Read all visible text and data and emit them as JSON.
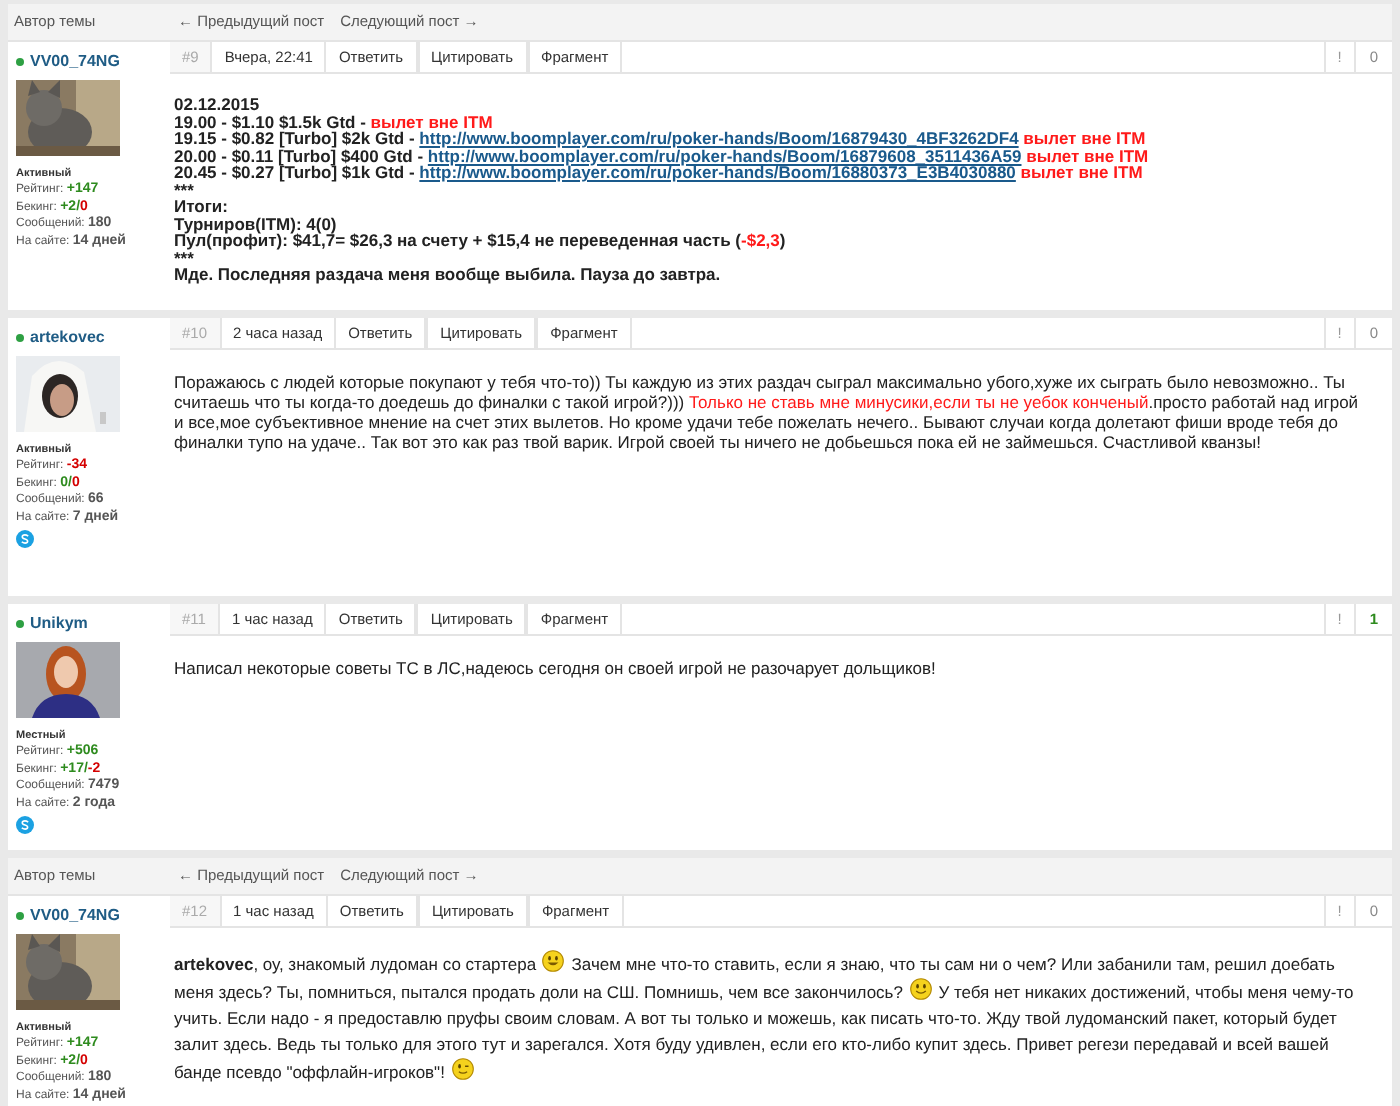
{
  "posts": [
    {
      "topic_starter_bar": {
        "label": "Автор темы",
        "prev": "← Предыдущий пост",
        "next": "Следующий пост →"
      },
      "author": {
        "name": "VV00_74NG",
        "online": true,
        "rank": "Активный",
        "skype": false,
        "stats": [
          {
            "label": "Рейтинг:",
            "parts": [
              {
                "text": "+147",
                "color": "#2e8b1e"
              }
            ]
          },
          {
            "label": "Бекинг:",
            "parts": [
              {
                "text": "+2/",
                "color": "#2e8b1e"
              },
              {
                "text": "0",
                "color": "#d40000"
              }
            ]
          },
          {
            "label": "Сообщений:",
            "parts": [
              {
                "text": "180",
                "color": "#555555"
              }
            ]
          },
          {
            "label": "На сайте:",
            "parts": [
              {
                "text": "14 дней",
                "color": "#555555"
              }
            ]
          }
        ]
      },
      "meta": {
        "number": "#9",
        "time": "Вчера, 22:41",
        "actions": [
          "Ответить",
          "Цитировать",
          "Фрагмент"
        ],
        "report": "!",
        "score": "0",
        "score_positive": false
      },
      "bold": true,
      "spaced": false,
      "lines": [
        [
          {
            "kind": "text",
            "text": "02.12.2015"
          }
        ],
        [
          {
            "kind": "text",
            "text": "19.00 - $1.10 $1.5k Gtd - "
          },
          {
            "kind": "text",
            "text": "вылет вне ITM",
            "red": true
          }
        ],
        [
          {
            "kind": "text",
            "text": "19.15 - $0.82 [Turbo] $2k Gtd - "
          },
          {
            "kind": "link",
            "text": "http://www.boomplayer.com/ru/poker-hands/Boom/16879430_4BF3262DF4"
          },
          {
            "kind": "text",
            "text": " вылет вне ITM",
            "red": true
          }
        ],
        [
          {
            "kind": "text",
            "text": "20.00 - $0.11 [Turbo] $400 Gtd - "
          },
          {
            "kind": "link",
            "text": "http://www.boomplayer.com/ru/poker-hands/Boom/16879608_3511436A59"
          },
          {
            "kind": "text",
            "text": " вылет вне ITM",
            "red": true
          }
        ],
        [
          {
            "kind": "text",
            "text": "20.45 - $0.27 [Turbo] $1k Gtd - "
          },
          {
            "kind": "link",
            "text": "http://www.boomplayer.com/ru/poker-hands/Boom/16880373_E3B4030880"
          },
          {
            "kind": "text",
            "text": " вылет вне ITM",
            "red": true
          }
        ],
        [
          {
            "kind": "text",
            "text": "***"
          }
        ],
        [
          {
            "kind": "text",
            "text": "Итоги:"
          }
        ],
        [
          {
            "kind": "text",
            "text": "Турниров(ITM): 4(0)"
          }
        ],
        [
          {
            "kind": "text",
            "text": "Пул(профит): $41,7= $26,3 на счету + $15,4 не переведенная часть ("
          },
          {
            "kind": "text",
            "text": "-$2,3",
            "red": true
          },
          {
            "kind": "text",
            "text": ")"
          }
        ],
        [
          {
            "kind": "text",
            "text": "***"
          }
        ],
        [
          {
            "kind": "text",
            "text": "Мде. Последняя раздача меня вообще выбила. Пауза до завтра."
          }
        ]
      ]
    },
    {
      "author": {
        "name": "artekovec",
        "online": true,
        "rank": "Активный",
        "skype": true,
        "stats": [
          {
            "label": "Рейтинг:",
            "parts": [
              {
                "text": "-34",
                "color": "#d40000"
              }
            ]
          },
          {
            "label": "Бекинг:",
            "parts": [
              {
                "text": "0/",
                "color": "#2e8b1e"
              },
              {
                "text": "0",
                "color": "#d40000"
              }
            ]
          },
          {
            "label": "Сообщений:",
            "parts": [
              {
                "text": "66",
                "color": "#555555"
              }
            ]
          },
          {
            "label": "На сайте:",
            "parts": [
              {
                "text": "7 дней",
                "color": "#555555"
              }
            ]
          }
        ]
      },
      "meta": {
        "number": "#10",
        "time": "2 часа назад",
        "actions": [
          "Ответить",
          "Цитировать",
          "Фрагмент"
        ],
        "report": "!",
        "score": "0",
        "score_positive": false
      },
      "bold": false,
      "spaced": false,
      "lines": [
        [
          {
            "kind": "text",
            "text": "Поражаюсь с людей которые покупают у тебя что-то)) Ты каждую из этих раздач сыграл максимально убого,хуже их сыграть было невозможно.. Ты считаешь что ты когда-то доедешь до финалки с такой игрой?))) "
          },
          {
            "kind": "text",
            "text": "Только не ставь мне минусики,если ты не уебок конченый",
            "red": true
          },
          {
            "kind": "text",
            "text": ".просто работай над игрой и все,мое субъективное мнение на счет этих вылетов. Но кроме удачи тебе пожелать нечего.. Бывают случаи когда долетают фиши вроде тебя до финалки тупо на удаче.. Так вот это как раз твой варик. Игрой своей ты ничего не добьешься пока ей не займешься. Счастливой кванзы!"
          }
        ]
      ]
    },
    {
      "author": {
        "name": "Unikym",
        "online": true,
        "rank": "Местный",
        "skype": true,
        "stats": [
          {
            "label": "Рейтинг:",
            "parts": [
              {
                "text": "+506",
                "color": "#2e8b1e"
              }
            ]
          },
          {
            "label": "Бекинг:",
            "parts": [
              {
                "text": "+17/",
                "color": "#2e8b1e"
              },
              {
                "text": "-2",
                "color": "#d40000"
              }
            ]
          },
          {
            "label": "Сообщений:",
            "parts": [
              {
                "text": "7479",
                "color": "#555555"
              }
            ]
          },
          {
            "label": "На сайте:",
            "parts": [
              {
                "text": "2 года",
                "color": "#555555"
              }
            ]
          }
        ]
      },
      "meta": {
        "number": "#11",
        "time": "1 час назад",
        "actions": [
          "Ответить",
          "Цитировать",
          "Фрагмент"
        ],
        "report": "!",
        "score": "1",
        "score_positive": true
      },
      "bold": false,
      "spaced": false,
      "lines": [
        [
          {
            "kind": "text",
            "text": "Написал некоторые советы ТС в ЛС,надеюсь сегодня он своей игрой не разочарует дольщиков!"
          }
        ]
      ]
    },
    {
      "topic_starter_bar": {
        "label": "Автор темы",
        "prev": "← Предыдущий пост",
        "next": "Следующий пост →"
      },
      "author": {
        "name": "VV00_74NG",
        "online": true,
        "rank": "Активный",
        "skype": false,
        "stats": [
          {
            "label": "Рейтинг:",
            "parts": [
              {
                "text": "+147",
                "color": "#2e8b1e"
              }
            ]
          },
          {
            "label": "Бекинг:",
            "parts": [
              {
                "text": "+2/",
                "color": "#2e8b1e"
              },
              {
                "text": "0",
                "color": "#d40000"
              }
            ]
          },
          {
            "label": "Сообщений:",
            "parts": [
              {
                "text": "180",
                "color": "#555555"
              }
            ]
          },
          {
            "label": "На сайте:",
            "parts": [
              {
                "text": "14 дней",
                "color": "#555555"
              }
            ]
          }
        ]
      },
      "meta": {
        "number": "#12",
        "time": "1 час назад",
        "actions": [
          "Ответить",
          "Цитировать",
          "Фрагмент"
        ],
        "report": "!",
        "score": "0",
        "score_positive": false
      },
      "bold": false,
      "spaced": true,
      "lines": [
        [
          {
            "kind": "text",
            "text": "artekovec",
            "bold": true
          },
          {
            "kind": "text",
            "text": ", оу, знакомый лудоман со стартера "
          },
          {
            "kind": "grin"
          },
          {
            "kind": "text",
            "text": " Зачем мне что-то ставить, если я знаю, что ты сам ни о чем? Или забанили там, решил доебать меня здесь? Ты, помниться, пытался продать доли на СШ. Помнишь, чем все закончилось? "
          },
          {
            "kind": "smile"
          },
          {
            "kind": "text",
            "text": " У тебя нет никаких достижений, чтобы меня чему-то учить. Если надо - я предоставлю пруфы своим словам. А вот ты только и можешь, как писать что-то. Жду твой лудоманский пакет, который будет залит здесь. Ведь ты только для этого тут и зарегался. Хотя буду удивлен, если его кто-либо купит здесь. Привет регези передавай и всей вашей банде псевдо \"оффлайн-игроков\"! "
          },
          {
            "kind": "wink"
          }
        ]
      ]
    }
  ]
}
